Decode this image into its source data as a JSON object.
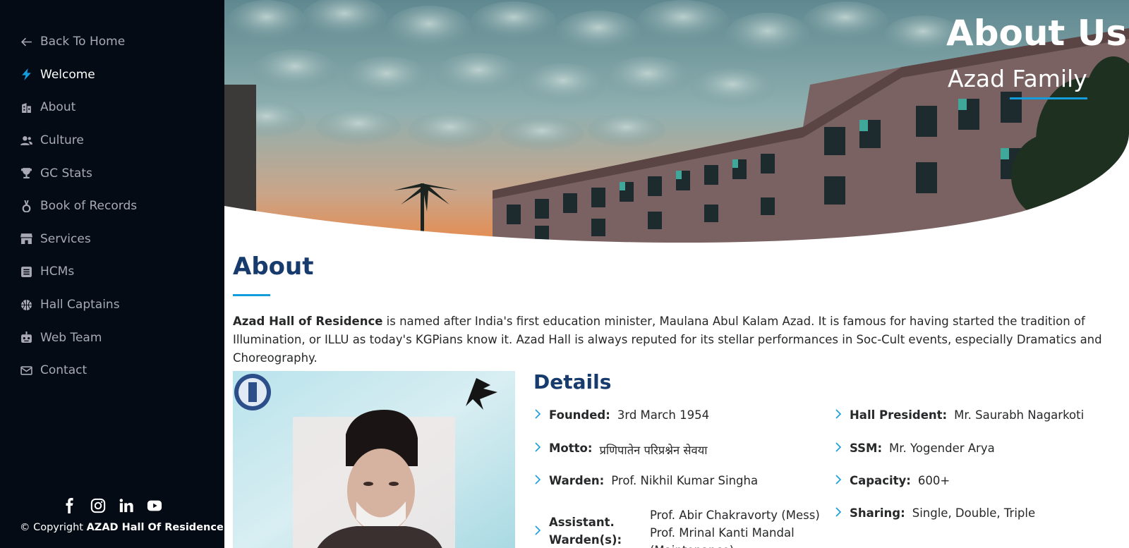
{
  "sidebar": {
    "items": [
      {
        "label": "Back To Home",
        "icon": "arrow-left-icon"
      },
      {
        "label": "Welcome",
        "icon": "lightning-icon",
        "active": true
      },
      {
        "label": "About",
        "icon": "building-icon"
      },
      {
        "label": "Culture",
        "icon": "people-icon"
      },
      {
        "label": "GC Stats",
        "icon": "trophy-icon"
      },
      {
        "label": "Book of Records",
        "icon": "medal-icon"
      },
      {
        "label": "Services",
        "icon": "shop-icon"
      },
      {
        "label": "HCMs",
        "icon": "list-icon"
      },
      {
        "label": "Hall Captains",
        "icon": "ball-icon"
      },
      {
        "label": "Web Team",
        "icon": "robot-icon"
      },
      {
        "label": "Contact",
        "icon": "envelope-icon"
      }
    ],
    "socials": [
      "facebook-icon",
      "instagram-icon",
      "linkedin-icon",
      "youtube-icon"
    ],
    "copyright_prefix": "© Copyright",
    "copyright_name": "AZAD Hall Of Residence"
  },
  "hero": {
    "title": "About Us",
    "subtitle": "Azad Family"
  },
  "about": {
    "title": "About",
    "text_bold": "Azad Hall of Residence",
    "text_rest": " is named after India's first education minister, Maulana Abul Kalam Azad. It is famous for having started the tradition of Illumination, or ILLU as today's KGPians know it. Azad Hall is always reputed for its stellar performances in Soc-Cult events, especially Dramatics and Choreography."
  },
  "details": {
    "title": "Details",
    "left": [
      {
        "label": "Founded:",
        "value": "3rd March 1954"
      },
      {
        "label": "Motto:",
        "value": "प्रणिपातेन परिप्रश्नेन सेवया"
      },
      {
        "label": "Warden:",
        "value": "Prof. Nikhil Kumar Singha"
      }
    ],
    "assistant": {
      "label": "Assistant. Warden(s):",
      "values": [
        "Prof. Abir Chakravorty (Mess)",
        "Prof. Mrinal Kanti Mandal",
        "(Maintenance)"
      ]
    },
    "right": [
      {
        "label": "Hall President:",
        "value": "Mr. Saurabh Nagarkoti"
      },
      {
        "label": "SSM:",
        "value": "Mr. Yogender Arya"
      },
      {
        "label": "Capacity:",
        "value": "600+"
      },
      {
        "label": "Sharing:",
        "value": "Single, Double, Triple"
      }
    ]
  },
  "colors": {
    "sidebar_bg": "#040b14",
    "accent": "#149ddd",
    "heading": "#173b6c"
  }
}
